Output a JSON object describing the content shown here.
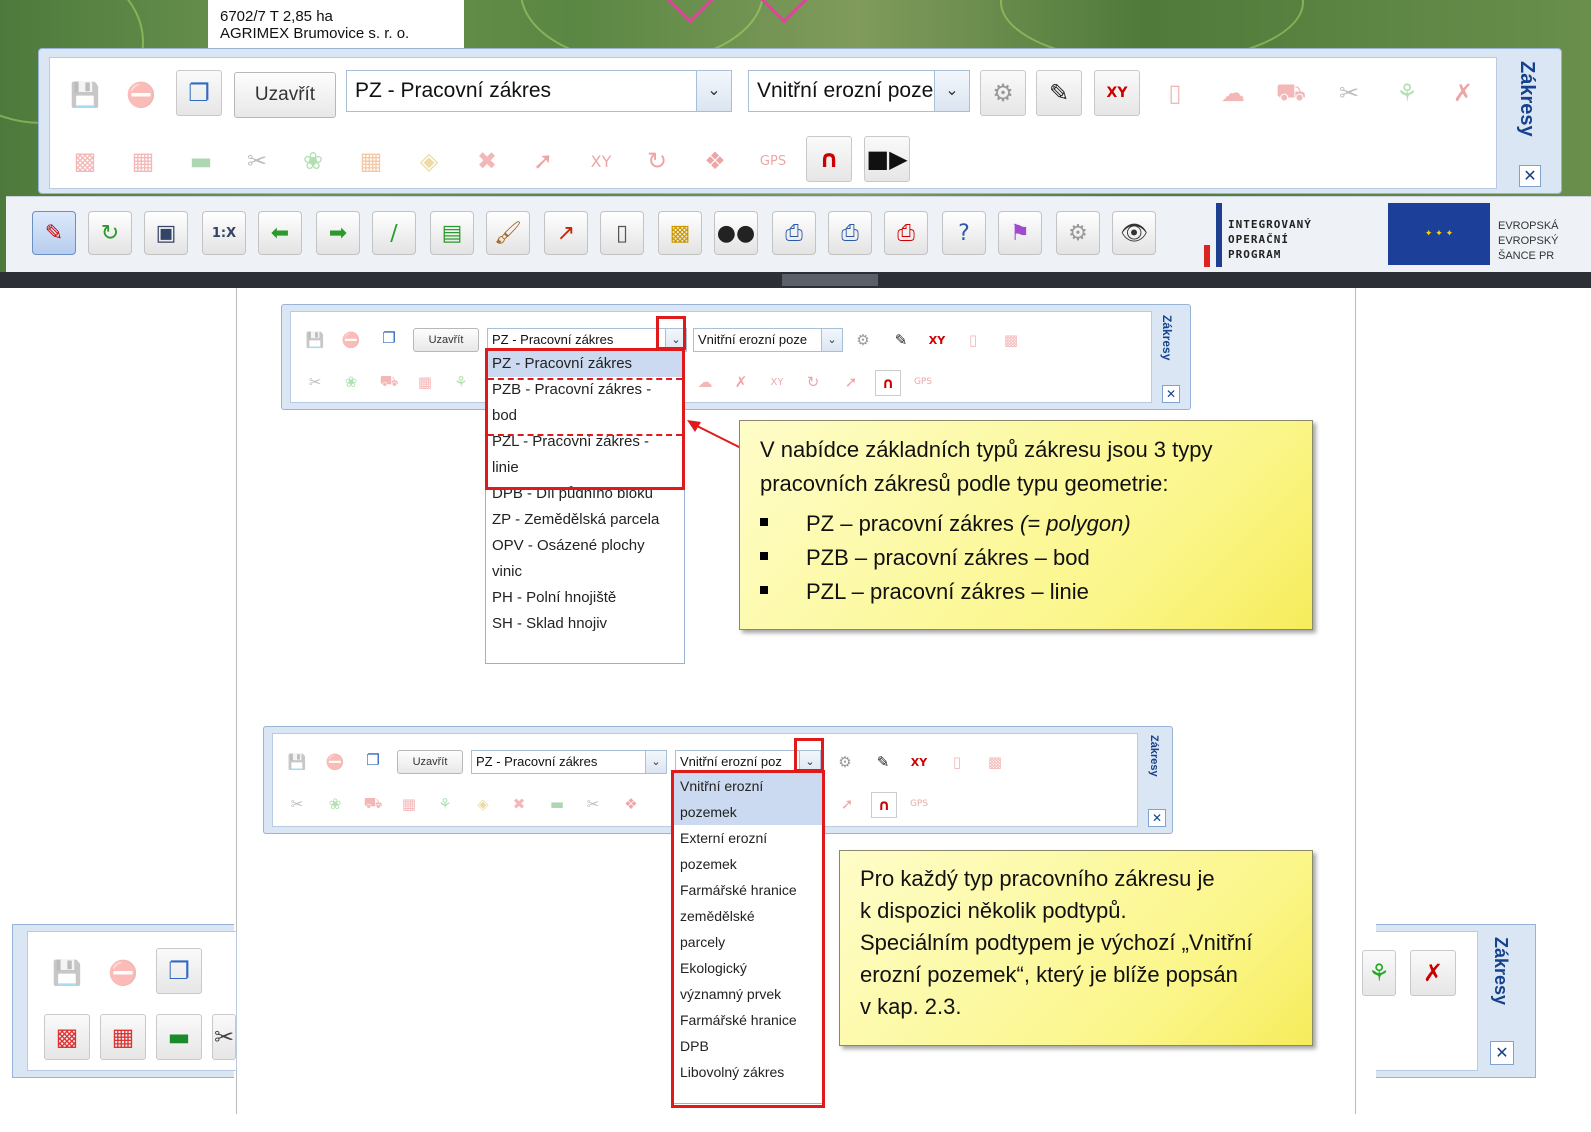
{
  "map": {
    "parcel_line1": "6702/7 T 2,85 ha",
    "parcel_line2": "AGRIMEX Brumovice s. r. o."
  },
  "panel": {
    "side_title": "Zákresy",
    "close_x": "✕",
    "close_button": "Uzavřít",
    "type_combo_value": "PZ - Pracovní zákres",
    "subtype_combo_value": "Vnitřní erozní poze",
    "xy_label": "XY",
    "xy_small_label": "XY",
    "gps_label": "GPS"
  },
  "bottom_toolbar": {
    "scale_label": "1:X",
    "iop_logo_text": [
      "INTEGROVANÝ",
      "OPERAČNÍ",
      "PROGRAM"
    ],
    "eu_text": [
      "EVROPSKÁ",
      "EVROPSKÝ",
      "ŠANCE PR"
    ]
  },
  "doc": {
    "panel1": {
      "side_title": "Zákresy",
      "close_button": "Uzavřít",
      "type_combo_value": "PZ - Pracovní zákres",
      "subtype_combo_value": "Vnitřní erozní poze",
      "gps_label": "GPS"
    },
    "type_dropdown": [
      "PZ - Pracovní zákres",
      "PZB - Pracovní zákres -",
      "bod",
      "PZL - Pracovní zákres -",
      "linie",
      "DPB - Díl půdního bloku",
      "ZP - Zemědělská parcela",
      "OPV - Osázené plochy",
      "vinic",
      "PH - Polní hnojiště",
      "SH - Sklad hnojiv"
    ],
    "callout1": {
      "line1": "V nabídce základních typů zákresu jsou 3 typy",
      "line2": "pracovních zákresů podle typu geometrie:",
      "bullets": [
        {
          "main": "PZ – pracovní zákres ",
          "italic": "(= polygon)"
        },
        {
          "main": "PZB – pracovní zákres – bod",
          "italic": ""
        },
        {
          "main": "PZL – pracovní zákres – linie",
          "italic": ""
        }
      ]
    },
    "panel2": {
      "side_title": "Zákresy",
      "close_button": "Uzavřít",
      "type_combo_value": "PZ - Pracovní zákres",
      "subtype_combo_value": "Vnitřní erozní poz",
      "gps_label": "GPS"
    },
    "subtype_dropdown": [
      "Vnitřní erozní",
      "pozemek",
      "Externí erozní",
      "pozemek",
      "Farmářské hranice",
      "zemědělské",
      "parcely",
      "Ekologický",
      "významný prvek",
      "Farmářské hranice",
      "DPB",
      "Libovolný zákres"
    ],
    "callout2": {
      "lines": [
        "Pro každý typ pracovního zákresu je",
        "k dispozici několik podtypů.",
        "Speciálním podtypem je výchozí „Vnitřní",
        "erozní pozemek“, který je blíže popsán",
        "v kap. 2.3."
      ]
    }
  },
  "crop_right": {
    "side_title": "Zákresy"
  }
}
